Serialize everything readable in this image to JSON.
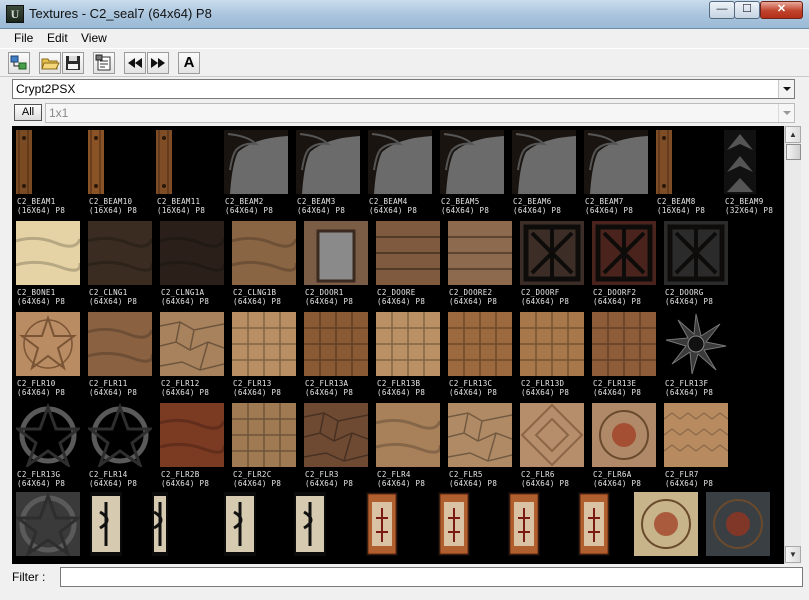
{
  "window": {
    "title": "Textures - C2_seal7 (64x64) P8",
    "minimize": "—",
    "maximize": "☐",
    "close": "✕"
  },
  "menu": {
    "file": "File",
    "edit": "Edit",
    "view": "View"
  },
  "toolbar": {
    "font_button": "A"
  },
  "package_combo": {
    "value": "Crypt2PSX"
  },
  "all_button": "All",
  "size_combo": {
    "value": "1x1"
  },
  "filter": {
    "label": "Filter :",
    "value": ""
  },
  "textures": [
    {
      "name": "C2_BEAM1",
      "size": "(16X64) P8",
      "style": "beam",
      "tint": "#7a4a22"
    },
    {
      "name": "C2_BEAM10",
      "size": "(16X64) P8",
      "style": "beam",
      "tint": "#8a5326"
    },
    {
      "name": "C2_BEAM11",
      "size": "(16X64) P8",
      "style": "beam",
      "tint": "#7e4c25"
    },
    {
      "name": "C2_BEAM2",
      "size": "(64X64) P8",
      "style": "corner",
      "tint": "#6b6b6b"
    },
    {
      "name": "C2_BEAM3",
      "size": "(64X64) P8",
      "style": "corner",
      "tint": "#6b6b6b"
    },
    {
      "name": "C2_BEAM4",
      "size": "(64X64) P8",
      "style": "corner",
      "tint": "#6b6b6b"
    },
    {
      "name": "C2_BEAM5",
      "size": "(64X64) P8",
      "style": "corner",
      "tint": "#6b6b6b"
    },
    {
      "name": "C2_BEAM6",
      "size": "(64X64) P8",
      "style": "corner",
      "tint": "#6b6b6b"
    },
    {
      "name": "C2_BEAM7",
      "size": "(64X64) P8",
      "style": "corner",
      "tint": "#6b6b6b"
    },
    {
      "name": "C2_BEAM8",
      "size": "(16X64) P8",
      "style": "beam",
      "tint": "#7e4c25"
    },
    {
      "name": "C2_BEAM9",
      "size": "(32X64) P8",
      "style": "beam2",
      "tint": "#555555"
    },
    {
      "name": "C2_BONE1",
      "size": "(64X64) P8",
      "style": "plain",
      "tint": "#e5d3a5"
    },
    {
      "name": "C2_CLNG1",
      "size": "(64X64) P8",
      "style": "plain",
      "tint": "#3a2c20"
    },
    {
      "name": "C2_CLNG1A",
      "size": "(64X64) P8",
      "style": "plain",
      "tint": "#2a2019"
    },
    {
      "name": "C2_CLNG1B",
      "size": "(64X64) P8",
      "style": "plain",
      "tint": "#8a6544"
    },
    {
      "name": "C2_DOOR1",
      "size": "(64X64) P8",
      "style": "door",
      "tint": "#7b5c45"
    },
    {
      "name": "C2_DOORE",
      "size": "(64X64) P8",
      "style": "planks",
      "tint": "#7f5a3e"
    },
    {
      "name": "C2_DOORE2",
      "size": "(64X64) P8",
      "style": "planks",
      "tint": "#8d6a4e"
    },
    {
      "name": "C2_DOORF",
      "size": "(64X64) P8",
      "style": "grate",
      "tint": "#3c2e27"
    },
    {
      "name": "C2_DOORF2",
      "size": "(64X64) P8",
      "style": "grate",
      "tint": "#4a241c"
    },
    {
      "name": "C2_DOORG",
      "size": "(64X64) P8",
      "style": "grate",
      "tint": "#2b2b2b"
    },
    {
      "name": "C2_FLR10",
      "size": "(64X64) P8",
      "style": "star",
      "tint": "#b98c64"
    },
    {
      "name": "C2_FLR11",
      "size": "(64X64) P8",
      "style": "plain",
      "tint": "#8a6242"
    },
    {
      "name": "C2_FLR12",
      "size": "(64X64) P8",
      "style": "stones",
      "tint": "#a8825c"
    },
    {
      "name": "C2_FLR13",
      "size": "(64X64) P8",
      "style": "tiles",
      "tint": "#b88e62"
    },
    {
      "name": "C2_FLR13A",
      "size": "(64X64) P8",
      "style": "tiles",
      "tint": "#8a5a34"
    },
    {
      "name": "C2_FLR13B",
      "size": "(64X64) P8",
      "style": "tiles",
      "tint": "#bb9064"
    },
    {
      "name": "C2_FLR13C",
      "size": "(64X64) P8",
      "style": "tiles",
      "tint": "#9c6a3e"
    },
    {
      "name": "C2_FLR13D",
      "size": "(64X64) P8",
      "style": "tiles",
      "tint": "#a9784a"
    },
    {
      "name": "C2_FLR13E",
      "size": "(64X64) P8",
      "style": "tiles",
      "tint": "#8e5c38"
    },
    {
      "name": "C2_FLR13F",
      "size": "(64X64) P8",
      "style": "spikestar",
      "tint": "#000000"
    },
    {
      "name": "C2_FLR13G",
      "size": "(64X64) P8",
      "style": "ringstar",
      "tint": "#000000"
    },
    {
      "name": "C2_FLR14",
      "size": "(64X64) P8",
      "style": "ringstar",
      "tint": "#000000"
    },
    {
      "name": "C2_FLR2B",
      "size": "(64X64) P8",
      "style": "plain",
      "tint": "#7b3a22"
    },
    {
      "name": "C2_FLR2C",
      "size": "(64X64) P8",
      "style": "tiles",
      "tint": "#a07a52"
    },
    {
      "name": "C2_FLR3",
      "size": "(64X64) P8",
      "style": "stones",
      "tint": "#6e4a33"
    },
    {
      "name": "C2_FLR4",
      "size": "(64X64) P8",
      "style": "plain",
      "tint": "#a8805a"
    },
    {
      "name": "C2_FLR5",
      "size": "(64X64) P8",
      "style": "stones",
      "tint": "#b08a64"
    },
    {
      "name": "C2_FLR6",
      "size": "(64X64) P8",
      "style": "diamond",
      "tint": "#b68e6b"
    },
    {
      "name": "C2_FLR6A",
      "size": "(64X64) P8",
      "style": "seal",
      "tint": "#b08a68"
    },
    {
      "name": "C2_FLR7",
      "size": "(64X64) P8",
      "style": "hex",
      "tint": "#b88a60"
    }
  ],
  "bottom_row": [
    {
      "style": "ringstar",
      "tint": "#3a3a3a",
      "w": 64
    },
    {
      "style": "rune",
      "tint": "#d6cbb0",
      "w": 32
    },
    {
      "style": "rune",
      "tint": "#d6cbb0",
      "w": 16
    },
    {
      "style": "rune",
      "tint": "#d6cbb0",
      "w": 32
    },
    {
      "style": "rune",
      "tint": "#d6cbb0",
      "w": 32
    },
    {
      "style": "banner",
      "tint": "#b0602e",
      "w": 32
    },
    {
      "style": "banner",
      "tint": "#b0602e",
      "w": 32
    },
    {
      "style": "banner",
      "tint": "#b0602e",
      "w": 32
    },
    {
      "style": "banner",
      "tint": "#b0602e",
      "w": 32
    },
    {
      "style": "seal",
      "tint": "#c7b48a",
      "w": 64
    },
    {
      "style": "seal",
      "tint": "#3a3f44",
      "w": 64
    }
  ]
}
